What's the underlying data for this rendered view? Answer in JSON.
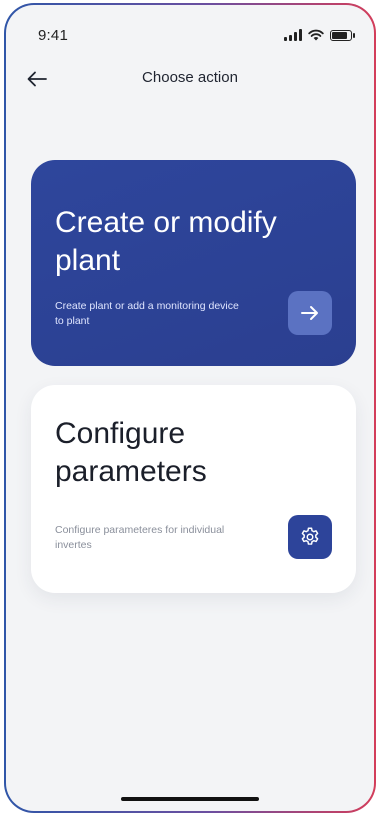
{
  "status_bar": {
    "time": "9:41"
  },
  "header": {
    "title": "Choose action"
  },
  "cards": [
    {
      "title": "Create or modify plant",
      "description": "Create plant or add a monitoring device to plant",
      "action_icon": "arrow-right-icon"
    },
    {
      "title": "Configure parameters",
      "description": "Configure parameteres for individual invertes",
      "action_icon": "gear-icon"
    }
  ],
  "colors": {
    "primary": "#2e469c",
    "background": "#f3f4f6",
    "text": "#1b1f2a"
  }
}
